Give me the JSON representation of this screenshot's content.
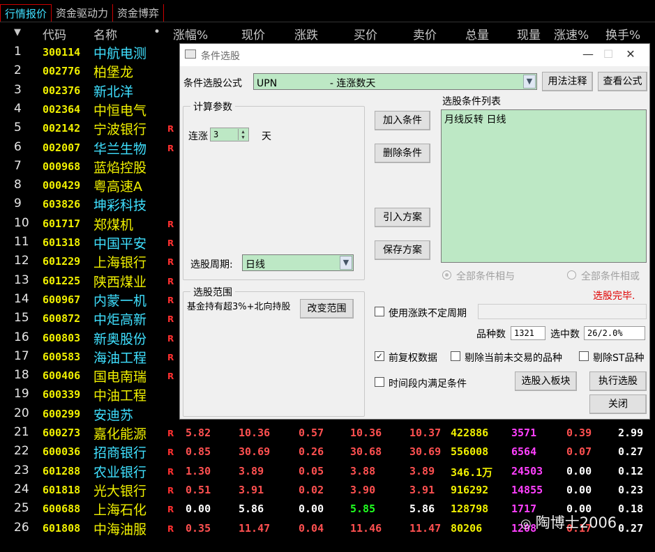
{
  "tabs": [
    "行情报价",
    "资金驱动力",
    "资金博弈"
  ],
  "header": {
    "sort": "▼",
    "code": "代码",
    "name": "名称",
    "dot": "•",
    "change_pct": "涨幅%",
    "price": "现价",
    "change": "涨跌",
    "bid": "买价",
    "ask": "卖价",
    "volume": "总量",
    "cur_vol": "现量",
    "speed": "涨速%",
    "turnover": "换手%"
  },
  "rows": [
    {
      "idx": "1",
      "code": "300114",
      "name": "中航电测",
      "r": "",
      "nc": "cyan"
    },
    {
      "idx": "2",
      "code": "002776",
      "name": "柏堡龙",
      "r": "",
      "nc": "yellow"
    },
    {
      "idx": "3",
      "code": "002376",
      "name": "新北洋",
      "r": "",
      "nc": "cyan"
    },
    {
      "idx": "4",
      "code": "002364",
      "name": "中恒电气",
      "r": "",
      "nc": "yellow"
    },
    {
      "idx": "5",
      "code": "002142",
      "name": "宁波银行",
      "r": "R",
      "nc": "yellow"
    },
    {
      "idx": "6",
      "code": "002007",
      "name": "华兰生物",
      "r": "R",
      "nc": "cyan"
    },
    {
      "idx": "7",
      "code": "000968",
      "name": "蓝焰控股",
      "r": "",
      "nc": "yellow"
    },
    {
      "idx": "8",
      "code": "000429",
      "name": "粤高速A",
      "r": "",
      "nc": "yellow"
    },
    {
      "idx": "9",
      "code": "603826",
      "name": "坤彩科技",
      "r": "",
      "nc": "cyan"
    },
    {
      "idx": "10",
      "code": "601717",
      "name": "郑煤机",
      "r": "R",
      "nc": "yellow"
    },
    {
      "idx": "11",
      "code": "601318",
      "name": "中国平安",
      "r": "R",
      "nc": "cyan"
    },
    {
      "idx": "12",
      "code": "601229",
      "name": "上海银行",
      "r": "R",
      "nc": "yellow"
    },
    {
      "idx": "13",
      "code": "601225",
      "name": "陕西煤业",
      "r": "R",
      "nc": "yellow"
    },
    {
      "idx": "14",
      "code": "600967",
      "name": "内蒙一机",
      "r": "R",
      "nc": "cyan"
    },
    {
      "idx": "15",
      "code": "600872",
      "name": "中炬高新",
      "r": "R",
      "nc": "cyan"
    },
    {
      "idx": "16",
      "code": "600803",
      "name": "新奥股份",
      "r": "R",
      "nc": "cyan"
    },
    {
      "idx": "17",
      "code": "600583",
      "name": "海油工程",
      "r": "R",
      "nc": "cyan"
    },
    {
      "idx": "18",
      "code": "600406",
      "name": "国电南瑞",
      "r": "R",
      "nc": "yellow"
    },
    {
      "idx": "19",
      "code": "600339",
      "name": "中油工程",
      "r": "",
      "nc": "yellow"
    },
    {
      "idx": "20",
      "code": "600299",
      "name": "安迪苏",
      "r": "",
      "nc": "cyan"
    },
    {
      "idx": "21",
      "code": "600273",
      "name": "嘉化能源",
      "r": "R",
      "nc": "yellow",
      "chg_pct": "5.82",
      "price": "10.36",
      "change": "0.57",
      "bid": "10.36",
      "ask": "10.37",
      "vol": "422886",
      "cur": "3571",
      "speed": "0.39",
      "turn": "2.99",
      "col": "red",
      "speed_col": "red"
    },
    {
      "idx": "22",
      "code": "600036",
      "name": "招商银行",
      "r": "R",
      "nc": "cyan",
      "chg_pct": "0.85",
      "price": "30.69",
      "change": "0.26",
      "bid": "30.68",
      "ask": "30.69",
      "vol": "556008",
      "cur": "6564",
      "speed": "0.07",
      "turn": "0.27",
      "col": "red",
      "speed_col": "red"
    },
    {
      "idx": "23",
      "code": "601288",
      "name": "农业银行",
      "r": "R",
      "nc": "cyan",
      "chg_pct": "1.30",
      "price": "3.89",
      "change": "0.05",
      "bid": "3.88",
      "ask": "3.89",
      "vol": "346.1万",
      "cur": "24503",
      "speed": "0.00",
      "turn": "0.12",
      "col": "red",
      "speed_col": "white"
    },
    {
      "idx": "24",
      "code": "601818",
      "name": "光大银行",
      "r": "R",
      "nc": "yellow",
      "chg_pct": "0.51",
      "price": "3.91",
      "change": "0.02",
      "bid": "3.90",
      "ask": "3.91",
      "vol": "916292",
      "cur": "14855",
      "speed": "0.00",
      "turn": "0.23",
      "col": "red",
      "speed_col": "white"
    },
    {
      "idx": "25",
      "code": "600688",
      "name": "上海石化",
      "r": "R",
      "nc": "yellow",
      "chg_pct": "0.00",
      "price": "5.86",
      "change": "0.00",
      "bid": "5.85",
      "ask": "5.86",
      "vol": "128798",
      "cur": "1717",
      "speed": "0.00",
      "turn": "0.18",
      "col": "white",
      "speed_col": "white",
      "bid_col": "green"
    },
    {
      "idx": "26",
      "code": "601808",
      "name": "中海油服",
      "r": "R",
      "nc": "yellow",
      "chg_pct": "0.35",
      "price": "11.47",
      "change": "0.04",
      "bid": "11.46",
      "ask": "11.47",
      "vol": "80206",
      "cur": "1208",
      "speed": "0.17",
      "turn": "0.27",
      "col": "red",
      "speed_col": "red"
    }
  ],
  "dialog": {
    "title": "条件选股",
    "min": "—",
    "max": "☐",
    "close": "✕",
    "formula_label": "条件选股公式",
    "formula_value": "UPN                 - 连涨数天",
    "usage_btn": "用法注释",
    "view_btn": "查看公式",
    "calc_params": "计算参数",
    "lianzhang": "连涨",
    "lianzhang_value": "3",
    "tian": "天",
    "add_cond": "加入条件",
    "del_cond": "删除条件",
    "import_plan": "引入方案",
    "save_plan": "保存方案",
    "cond_list_label": "选股条件列表",
    "cond_list_item": "月线反转  日线",
    "period_label": "选股周期:",
    "period_value": "日线",
    "radio_and": "全部条件相与",
    "radio_or": "全部条件相或",
    "status": "选股完毕.",
    "range_label": "选股范围",
    "range_text": "基金持有超3%+北向持股",
    "change_range": "改变范围",
    "use_period": "使用涨跌不定周期",
    "varieties_label": "品种数",
    "varieties_value": "1321",
    "selected_label": "选中数",
    "selected_value": "26/2.0%",
    "fq": "前复权数据",
    "exclude_untraded": "剔除当前未交易的品种",
    "exclude_st": "剔除ST品种",
    "time_cond": "时间段内满足条件",
    "to_block": "选股入板块",
    "execute": "执行选股",
    "close_btn": "关闭"
  },
  "watermark": "陶博士2006"
}
